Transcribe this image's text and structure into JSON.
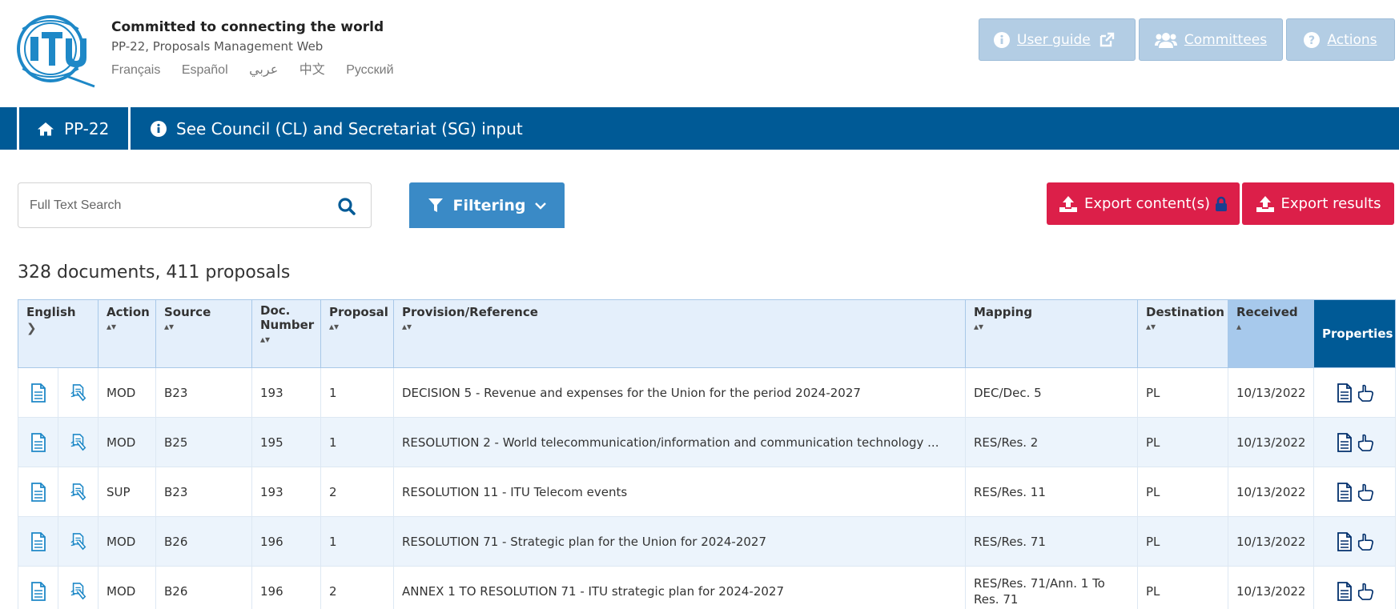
{
  "header": {
    "title": "Committed to connecting the world",
    "subtitle": "PP-22, Proposals Management Web",
    "languages": [
      "Français",
      "Español",
      "عربي",
      "中文",
      "Русский"
    ],
    "buttons": {
      "user_guide": "User guide",
      "committees": "Committees",
      "actions": "Actions"
    }
  },
  "navbar": {
    "home": "PP-22",
    "input_link": "See Council (CL) and Secretariat (SG) input"
  },
  "toolbar": {
    "search_placeholder": "Full Text Search",
    "filtering": "Filtering",
    "export_content": "Export content(s)",
    "export_results": "Export results"
  },
  "summary": "328 documents, 411 proposals",
  "table": {
    "columns": {
      "english": "English",
      "action": "Action",
      "source": "Source",
      "doc_number": "Doc. Number",
      "proposal": "Proposal",
      "provision": "Provision/Reference",
      "mapping": "Mapping",
      "destination": "Destination",
      "received": "Received",
      "properties": "Properties"
    },
    "rows": [
      {
        "action": "MOD",
        "source": "B23",
        "doc_number": "193",
        "proposal": "1",
        "provision": "DECISION 5 - Revenue and expenses for the Union for the period 2024-2027",
        "mapping": "DEC/Dec. 5",
        "destination": "PL",
        "received": "10/13/2022"
      },
      {
        "action": "MOD",
        "source": "B25",
        "doc_number": "195",
        "proposal": "1",
        "provision": "RESOLUTION 2 - World telecommunication/information and communication technology ...",
        "mapping": "RES/Res. 2",
        "destination": "PL",
        "received": "10/13/2022"
      },
      {
        "action": "SUP",
        "source": "B23",
        "doc_number": "193",
        "proposal": "2",
        "provision": "RESOLUTION 11 - ITU Telecom events",
        "mapping": "RES/Res. 11",
        "destination": "PL",
        "received": "10/13/2022"
      },
      {
        "action": "MOD",
        "source": "B26",
        "doc_number": "196",
        "proposal": "1",
        "provision": "RESOLUTION 71 - Strategic plan for the Union for 2024-2027",
        "mapping": "RES/Res. 71",
        "destination": "PL",
        "received": "10/13/2022"
      },
      {
        "action": "MOD",
        "source": "B26",
        "doc_number": "196",
        "proposal": "2",
        "provision": "ANNEX 1 TO RESOLUTION 71 - ITU strategic plan for 2024-2027",
        "mapping": "RES/Res. 71/Ann. 1 To Res. 71",
        "destination": "PL",
        "received": "10/13/2022"
      }
    ]
  },
  "colors": {
    "nav": "#005a96",
    "header_button": "#b3cde4",
    "filter_button": "#3a8ac6",
    "export_button": "#dc1f49",
    "table_header": "#e4effb"
  },
  "icons": [
    "itu-logo",
    "info-icon",
    "external-link-icon",
    "users-icon",
    "question-icon",
    "home-icon",
    "search-icon",
    "filter-icon",
    "chevron-down-icon",
    "upload-icon",
    "lock-icon",
    "document-icon",
    "document-translate-icon",
    "properties-icon",
    "hand-pointer-icon"
  ]
}
